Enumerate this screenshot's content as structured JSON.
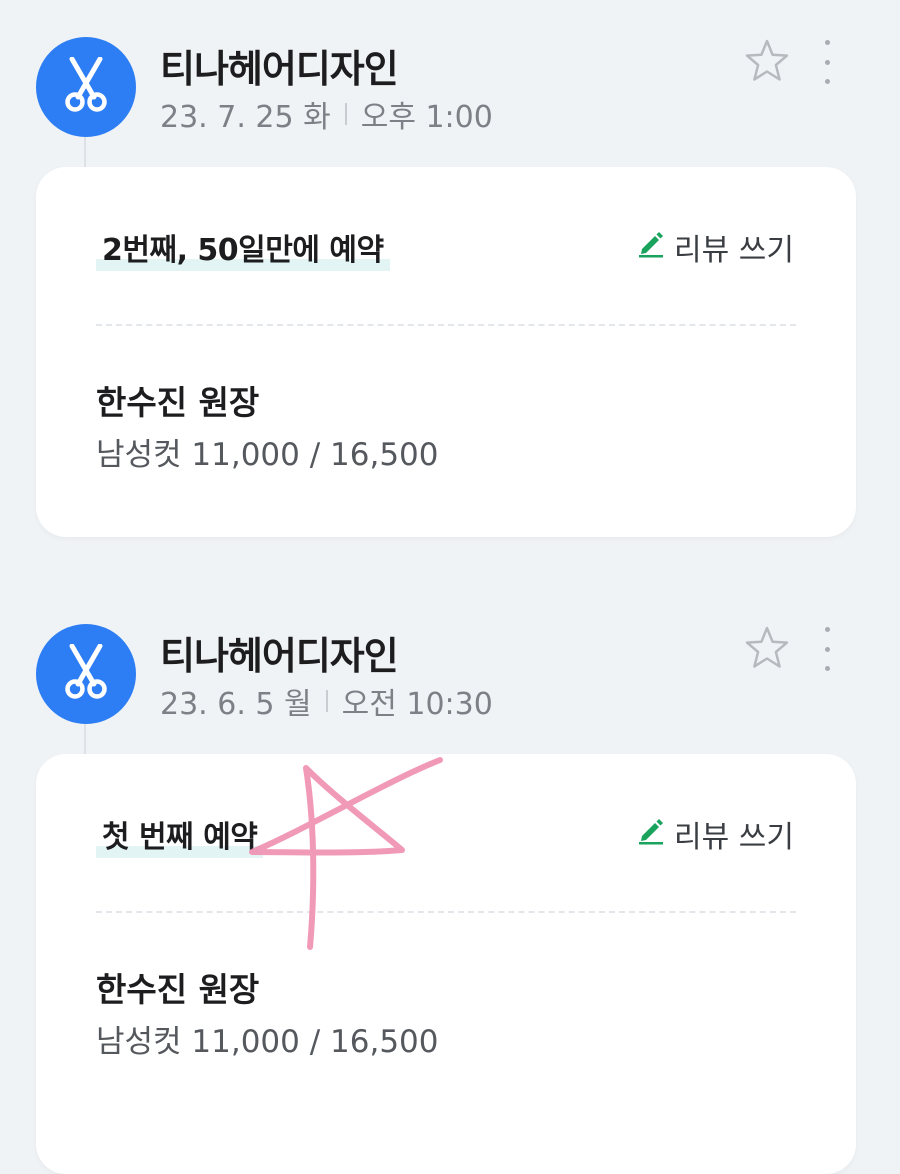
{
  "colors": {
    "background": "#f0f3f6",
    "avatar": "#2d7df4",
    "review_icon": "#1aa35d",
    "title_highlight": "#e2f5f4",
    "doodle": "#ef8fb0"
  },
  "reservations": [
    {
      "shop_name": "티나헤어디자인",
      "date": "23. 7. 25 화",
      "time": "오후 1:00",
      "title": "2번째, 50일만에 예약",
      "review_label": "리뷰 쓰기",
      "designer": "한수진 원장",
      "service": "남성컷 11,000 / 16,500"
    },
    {
      "shop_name": "티나헤어디자인",
      "date": "23. 6. 5 월",
      "time": "오전 10:30",
      "title": "첫 번째 예약",
      "review_label": "리뷰 쓰기",
      "designer": "한수진 원장",
      "service": "남성컷 11,000 / 16,500"
    }
  ],
  "icons": {
    "avatar": "scissors-icon",
    "favorite": "star-outline-icon",
    "more": "more-vertical-icon",
    "review": "pencil-icon",
    "doodle": "hand-drawn-star"
  }
}
